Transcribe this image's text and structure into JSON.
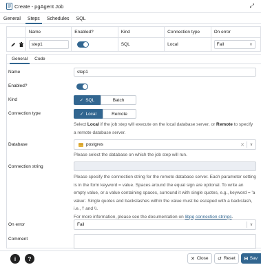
{
  "window": {
    "title": "Create - pgAgent Job"
  },
  "top_tabs": [
    "General",
    "Steps",
    "Schedules",
    "SQL"
  ],
  "grid": {
    "headers": [
      "Name",
      "Enabled?",
      "Kind",
      "Connection type",
      "On error"
    ],
    "row": {
      "name": "step1",
      "enabled": true,
      "kind": "SQL",
      "connection_type": "Local",
      "on_error": "Fail"
    }
  },
  "sub_tabs": [
    "General",
    "Code"
  ],
  "form": {
    "name_label": "Name",
    "name_value": "step1",
    "enabled_label": "Enabled?",
    "enabled": true,
    "kind_label": "Kind",
    "kind_options": [
      "SQL",
      "Batch"
    ],
    "kind_selected": "SQL",
    "conn_type_label": "Connection type",
    "conn_type_options": [
      "Local",
      "Remote"
    ],
    "conn_type_selected": "Local",
    "conn_type_help_1": "Select ",
    "conn_type_help_local": "Local",
    "conn_type_help_2": " if the job step will execute on the local database server, or ",
    "conn_type_help_remote": "Remote",
    "conn_type_help_3": " to specify a remote database server.",
    "database_label": "Database",
    "database_value": "postgres",
    "database_help": "Please select the database on which the job step will run.",
    "conn_string_label": "Connection string",
    "conn_string_value": "",
    "conn_string_help": "Please specify the connection string for the remote database server. Each parameter setting is in the form keyword = value. Spaces around the equal sign are optional. To write an empty value, or a value containing spaces, surround it with single quotes, e.g., keyword = 'a value'. Single quotes and backslashes within the value must be escaped with a backslash, i.e., \\' and \\\\.",
    "conn_string_help_more": "For more information, please see the documentation on ",
    "conn_string_help_link": "libpq connection strings",
    "conn_string_help_end": ".",
    "on_error_label": "On error",
    "on_error_value": "Fail",
    "comment_label": "Comment",
    "comment_value": ""
  },
  "footer": {
    "info_icon": "i",
    "help_icon": "?",
    "close_label": "Close",
    "reset_label": "Reset",
    "save_label": "Sav"
  },
  "colors": {
    "accent": "#326690",
    "border": "#dde0e6",
    "disabled_bg": "#ebeef3"
  }
}
